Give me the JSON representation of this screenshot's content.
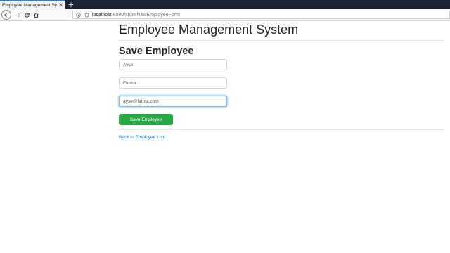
{
  "browser": {
    "tab_title": "Employee Management System",
    "tab_close": "×",
    "new_tab": "+",
    "url_host": "localhost",
    "url_path": ":8080/showNewEmployeeForm"
  },
  "page": {
    "title": "Employee Management System",
    "section_title": "Save Employee"
  },
  "form": {
    "first_name_value": "Ayşe",
    "last_name_value": "Fatma",
    "email_value": "ayşe@fatma.com",
    "save_label": "Save Employee"
  },
  "links": {
    "back_label": "Back to Employee List"
  },
  "colors": {
    "accent_button": "#28a745",
    "link": "#007bff",
    "tab_strip": "#1c2333"
  },
  "icons": [
    "back-arrow-icon",
    "forward-arrow-icon",
    "reload-icon",
    "home-icon",
    "shield-icon",
    "info-icon",
    "close-icon",
    "plus-icon"
  ]
}
